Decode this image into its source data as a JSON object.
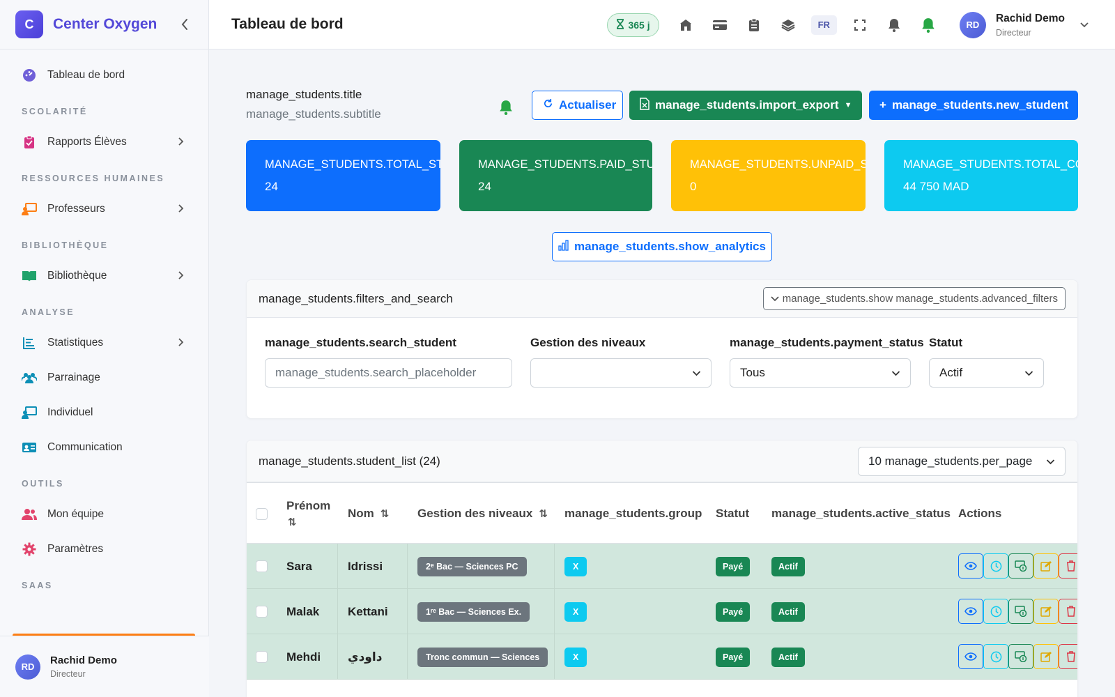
{
  "brand": {
    "initial": "C",
    "name": "Center Oxygen"
  },
  "sidebar": {
    "items": [
      {
        "type": "item",
        "label": "Tableau de bord",
        "icon": "dashboard-icon",
        "chevron": false
      },
      {
        "type": "section",
        "label": "SCOLARITÉ"
      },
      {
        "type": "item",
        "label": "Rapports Élèves",
        "icon": "clipboard-icon",
        "chevron": true
      },
      {
        "type": "section",
        "label": "RESSOURCES HUMAINES"
      },
      {
        "type": "item",
        "label": "Professeurs",
        "icon": "teacher-icon",
        "chevron": true
      },
      {
        "type": "section",
        "label": "BIBLIOTHÈQUE"
      },
      {
        "type": "item",
        "label": "Bibliothèque",
        "icon": "book-icon",
        "chevron": true
      },
      {
        "type": "section",
        "label": "ANALYSE"
      },
      {
        "type": "item",
        "label": "Statistiques",
        "icon": "chart-icon",
        "chevron": true
      },
      {
        "type": "item",
        "label": "Parrainage",
        "icon": "users-icon",
        "chevron": false
      },
      {
        "type": "item",
        "label": "Individuel",
        "icon": "board-icon",
        "chevron": false
      },
      {
        "type": "item",
        "label": "Communication",
        "icon": "id-card-icon",
        "chevron": false
      },
      {
        "type": "section",
        "label": "OUTILS"
      },
      {
        "type": "item",
        "label": "Mon équipe",
        "icon": "team-icon",
        "chevron": false
      },
      {
        "type": "item",
        "label": "Paramètres",
        "icon": "gear-icon",
        "chevron": false
      },
      {
        "type": "section",
        "label": "SAAS"
      }
    ]
  },
  "user": {
    "initials": "RD",
    "name": "Rachid Demo",
    "role": "Directeur"
  },
  "topbar": {
    "title": "Tableau de bord",
    "days": "365 j",
    "lang": "FR"
  },
  "header": {
    "title": "manage_students.title",
    "subtitle": "manage_students.subtitle",
    "refresh": "Actualiser",
    "import_export": "manage_students.import_export",
    "new_student": "manage_students.new_student"
  },
  "stats": [
    {
      "label": "MANAGE_STUDENTS.TOTAL_STUDENTS",
      "value": "24"
    },
    {
      "label": "MANAGE_STUDENTS.PAID_STUDENTS",
      "value": "24"
    },
    {
      "label": "MANAGE_STUDENTS.UNPAID_STUDENTS",
      "value": "0"
    },
    {
      "label": "MANAGE_STUDENTS.TOTAL_COLLECTED",
      "value": "44 750 MAD"
    }
  ],
  "analytics_btn": "manage_students.show_analytics",
  "filters": {
    "title": "manage_students.filters_and_search",
    "advanced": "manage_students.show manage_students.advanced_filters",
    "search_label": "manage_students.search_student",
    "search_placeholder": "manage_students.search_placeholder",
    "level_label": "Gestion des niveaux",
    "level_value": "",
    "payment_label": "manage_students.payment_status",
    "payment_value": "Tous",
    "status_label": "Statut",
    "status_value": "Actif"
  },
  "list": {
    "title": "manage_students.student_list (24)",
    "per_page": "10 manage_students.per_page",
    "columns": {
      "first": "Prénom",
      "last": "Nom",
      "level": "Gestion des niveaux",
      "group": "manage_students.group",
      "status": "Statut",
      "active": "manage_students.active_status",
      "actions": "Actions"
    },
    "rows": [
      {
        "first": "Sara",
        "last": "Idrissi",
        "level": "2ᵉ Bac — Sciences PC",
        "group": "X",
        "status": "Payé",
        "active": "Actif"
      },
      {
        "first": "Malak",
        "last": "Kettani",
        "level": "1ʳᵉ Bac — Sciences Ex.",
        "group": "X",
        "status": "Payé",
        "active": "Actif"
      },
      {
        "first": "Mehdi",
        "last": "داودي",
        "level": "Tronc commun — Sciences",
        "group": "X",
        "status": "Payé",
        "active": "Actif"
      }
    ]
  },
  "colors": {
    "primary": "#0d6efd",
    "success": "#198754",
    "warning": "#ffc107",
    "info": "#0dcaf0",
    "brand": "#5348d8",
    "row_bg": "#d1e7dd"
  }
}
